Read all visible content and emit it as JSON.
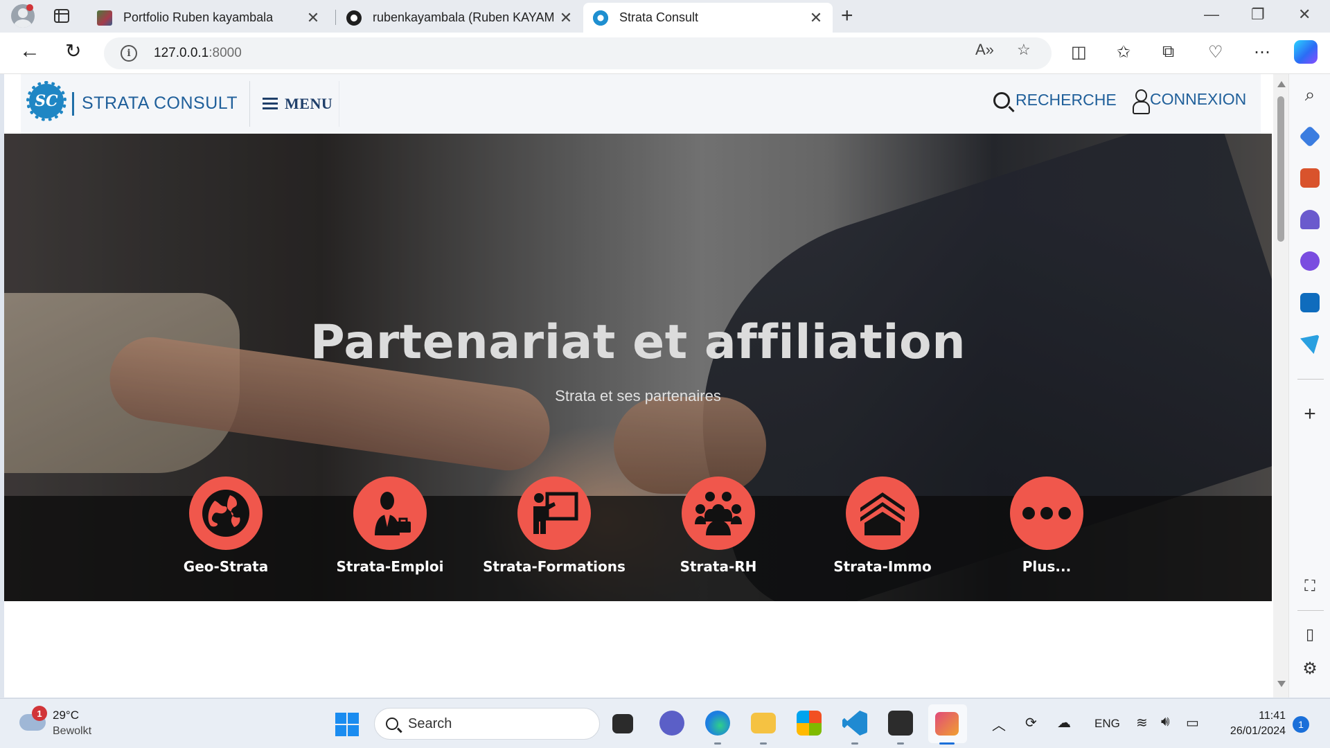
{
  "browser": {
    "tabs": [
      {
        "title": "Portfolio Ruben kayambala",
        "active": false
      },
      {
        "title": "rubenkayambala (Ruben KAYAMBALA)",
        "active": false
      },
      {
        "title": "Strata Consult",
        "active": true
      }
    ],
    "url_host": "127.0.0.1",
    "url_port": ":8000"
  },
  "site": {
    "logo_text": "SC",
    "brand": "STRATA CONSULT",
    "menu_label": "MENU",
    "search_label": "RECHERCHE",
    "login_label": "CONNEXION"
  },
  "hero": {
    "title": "Partenariat et affiliation",
    "subtitle": "Strata et ses partenaires"
  },
  "services": [
    {
      "label": "Geo-Strata",
      "icon": "globe-icon"
    },
    {
      "label": "Strata-Emploi",
      "icon": "employee-icon"
    },
    {
      "label": "Strata-Formations",
      "icon": "teacher-board-icon"
    },
    {
      "label": "Strata-RH",
      "icon": "group-people-icon"
    },
    {
      "label": "Strata-Immo",
      "icon": "house-icon"
    },
    {
      "label": "Plus...",
      "icon": "more-dots-icon"
    }
  ],
  "colors": {
    "accent": "#f0574c",
    "brand_blue": "#1f5f9a"
  },
  "taskbar": {
    "weather_temp": "29°C",
    "weather_desc": "Bewolkt",
    "weather_badge": "1",
    "search_placeholder": "Search",
    "language": "ENG",
    "time": "11:41",
    "date": "26/01/2024",
    "notification_count": "1"
  }
}
